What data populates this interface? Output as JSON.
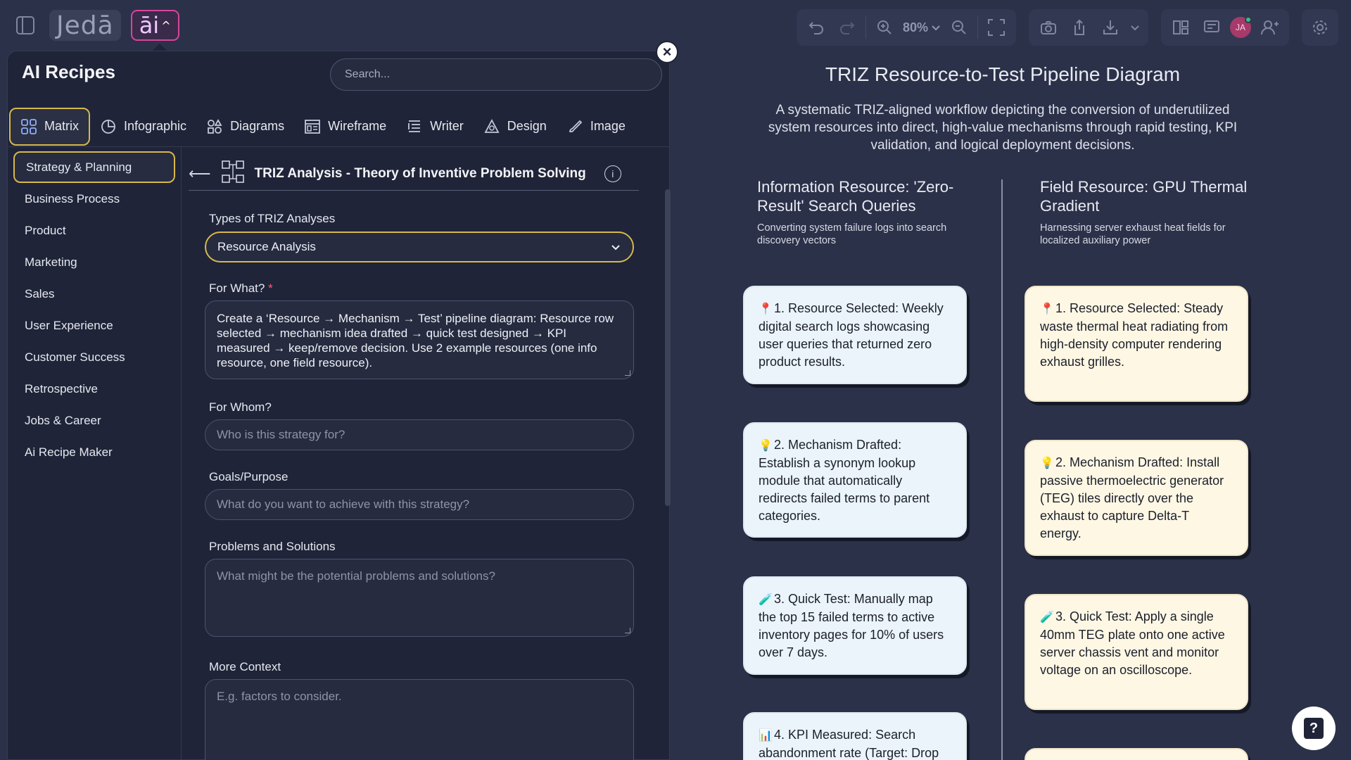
{
  "app": {
    "logo_text": "Jedā",
    "ai_button_label": "āi"
  },
  "toolbar": {
    "zoom_label": "80%"
  },
  "panel": {
    "title": "AI Recipes",
    "search_placeholder": "Search...",
    "tabs": [
      {
        "label": "Matrix",
        "icon": "grid-icon"
      },
      {
        "label": "Infographic",
        "icon": "pie-chart-icon"
      },
      {
        "label": "Diagrams",
        "icon": "shapes-icon"
      },
      {
        "label": "Wireframe",
        "icon": "wireframe-icon"
      },
      {
        "label": "Writer",
        "icon": "text-lines-icon"
      },
      {
        "label": "Design",
        "icon": "design-icon"
      },
      {
        "label": "Image",
        "icon": "image-brush-icon"
      }
    ],
    "categories": [
      "Strategy & Planning",
      "Business Process",
      "Product",
      "Marketing",
      "Sales",
      "User Experience",
      "Customer Success",
      "Retrospective",
      "Jobs & Career",
      "Ai Recipe Maker"
    ],
    "recipe": {
      "title": "TRIZ Analysis - Theory of Inventive Problem Solving",
      "type_label": "Types of TRIZ Analyses",
      "type_value": "Resource Analysis",
      "for_what_label": "For What?",
      "required_mark": "*",
      "for_what_value": "Create a ‘Resource → Mechanism → Test’ pipeline diagram: Resource row selected → mechanism idea drafted → quick test designed → KPI measured → keep/remove decision. Use 2 example resources (one info resource, one field resource).",
      "for_whom_label": "For Whom?",
      "for_whom_placeholder": "Who is this strategy for?",
      "goals_label": "Goals/Purpose",
      "goals_placeholder": "What do you want to achieve with this strategy?",
      "problems_label": "Problems and Solutions",
      "problems_placeholder": "What might be the potential problems and solutions?",
      "context_label": "More Context",
      "context_placeholder": "E.g. factors to consider."
    }
  },
  "diagram": {
    "title": "TRIZ Resource-to-Test Pipeline Diagram",
    "subtitle": "A systematic TRIZ-aligned workflow depicting the conversion of underutilized system resources into direct, high-value mechanisms through rapid testing, KPI validation, and logical deployment decisions.",
    "columns": [
      {
        "title": "Information Resource: 'Zero-Result' Search Queries",
        "desc": "Converting system failure logs into search discovery vectors",
        "cards": [
          {
            "emoji": "📍",
            "text": "1. Resource Selected: Weekly digital search logs showcasing user queries that returned zero product results."
          },
          {
            "emoji": "💡",
            "text": "2. Mechanism Drafted: Establish a synonym lookup module that automatically redirects failed terms to parent categories."
          },
          {
            "emoji": "🧪",
            "text": "3. Quick Test: Manually map the top 15 failed terms to active inventory pages for 10% of users over 7 days."
          },
          {
            "emoji": "📊",
            "text": "4. KPI Measured: Search abandonment rate (Target: Drop"
          }
        ]
      },
      {
        "title": "Field Resource: GPU Thermal Gradient",
        "desc": "Harnessing server exhaust heat fields for localized auxiliary power",
        "cards": [
          {
            "emoji": "📍",
            "text": "1. Resource Selected: Steady waste thermal heat radiating from high-density computer rendering exhaust grilles."
          },
          {
            "emoji": "💡",
            "text": "2. Mechanism Drafted: Install passive thermoelectric generator (TEG) tiles directly over the exhaust to capture Delta-T energy."
          },
          {
            "emoji": "🧪",
            "text": "3. Quick Test: Apply a single 40mm TEG plate onto one active server chassis vent and monitor voltage on an oscilloscope."
          },
          {
            "emoji": "",
            "text": ""
          }
        ]
      }
    ]
  },
  "help": {
    "label": "?"
  },
  "colors": {
    "background": "#2b3149",
    "panel": "#1f2438",
    "accent_gold": "#d7b84a",
    "ai_pink": "#d9459a",
    "card_blue": "#eaf4fa",
    "card_cream": "#fdf7e4"
  }
}
